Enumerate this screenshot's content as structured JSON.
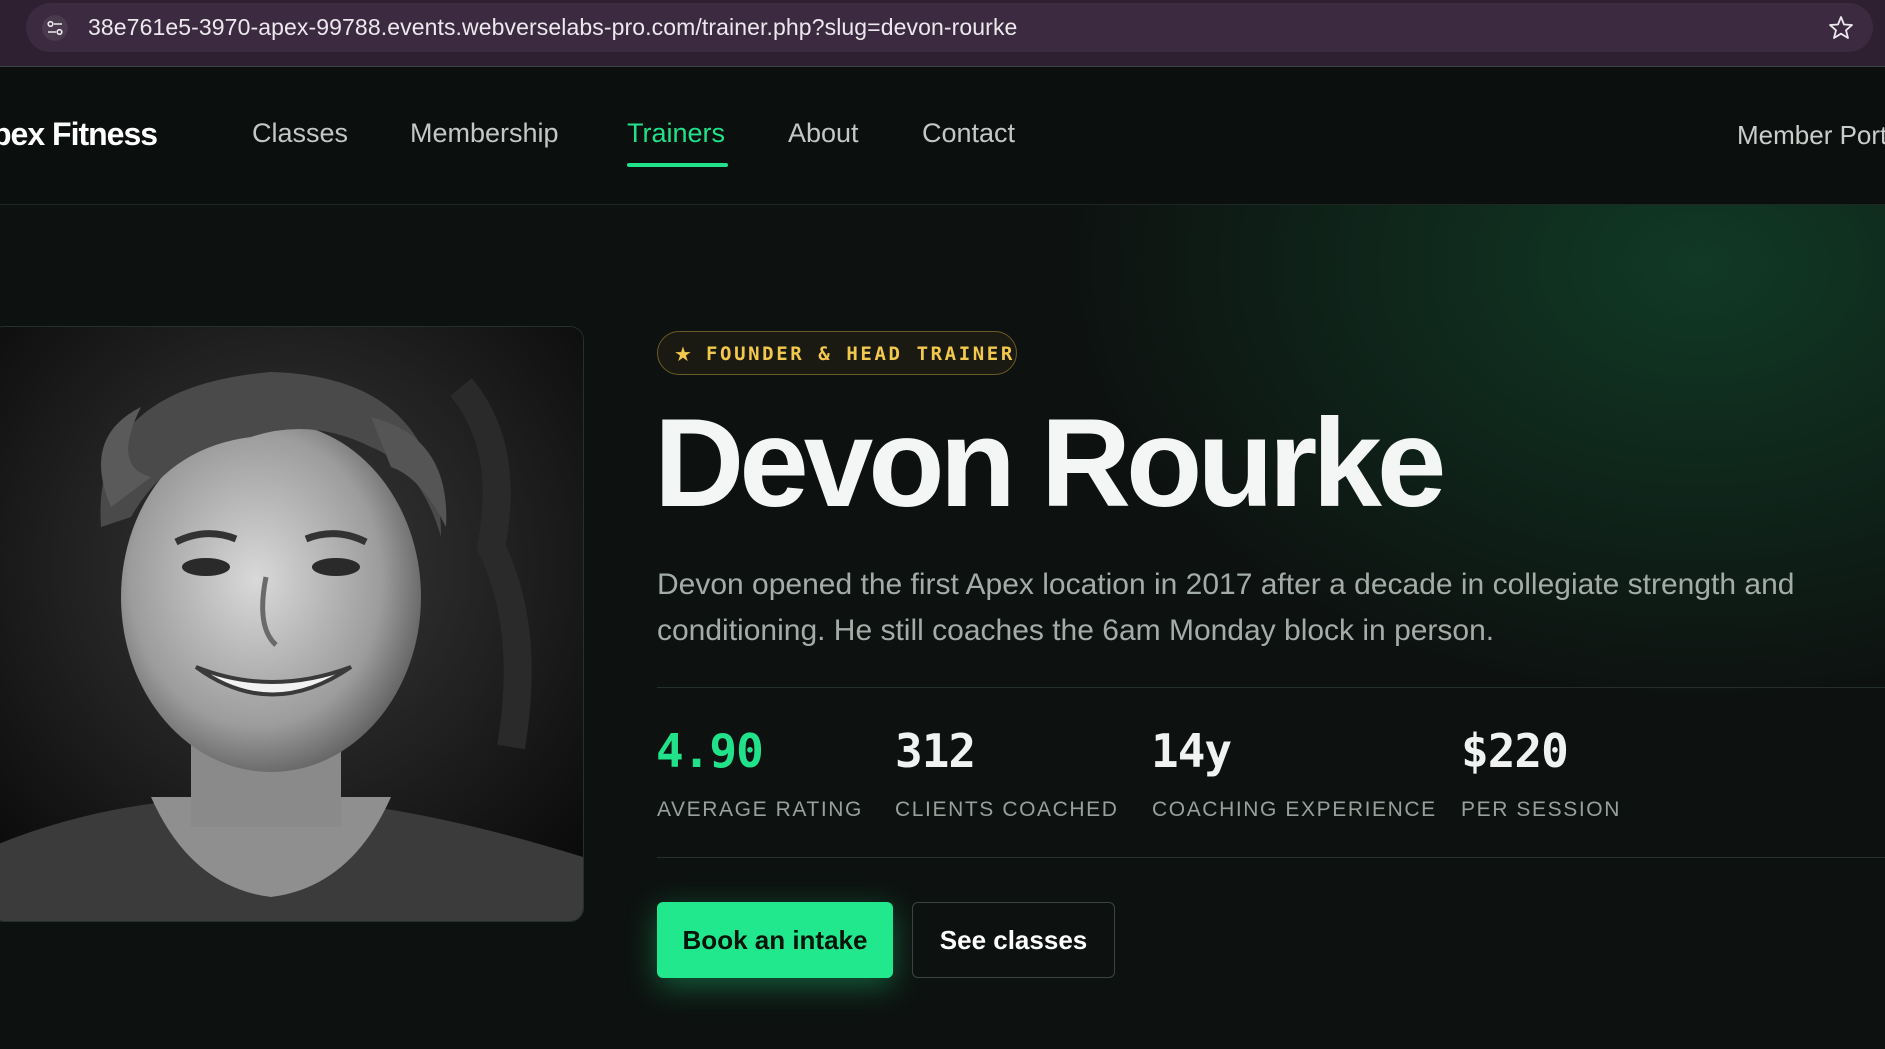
{
  "browser": {
    "url": "38e761e5-3970-apex-99788.events.webverselabs-pro.com/trainer.php?slug=devon-rourke",
    "site_icon": "tune-icon",
    "bookmark_icon": "star-outline-icon"
  },
  "header": {
    "logo": "pex Fitness",
    "nav": [
      "Classes",
      "Membership",
      "Trainers",
      "About",
      "Contact"
    ],
    "active_nav": "Trainers",
    "member_portal": "Member Port"
  },
  "trainer": {
    "badge": "FOUNDER & HEAD TRAINER",
    "badge_icon": "star-icon",
    "name": "Devon Rourke",
    "bio": "Devon opened the first Apex location in 2017 after a decade in collegiate strength and conditioning. He still coaches the 6am Monday block in person.",
    "photo": "trainer-portrait-photo",
    "stats": [
      {
        "value": "4.90",
        "label": "AVERAGE RATING"
      },
      {
        "value": "312",
        "label": "CLIENTS COACHED"
      },
      {
        "value": "14y",
        "label": "COACHING EXPERIENCE"
      },
      {
        "value": "$220",
        "label": "PER SESSION"
      }
    ],
    "primary_cta": "Book an intake",
    "secondary_cta": "See classes"
  },
  "colors": {
    "accent": "#21e28a",
    "badge_gold": "#f2c94c",
    "background": "#0d1210"
  }
}
